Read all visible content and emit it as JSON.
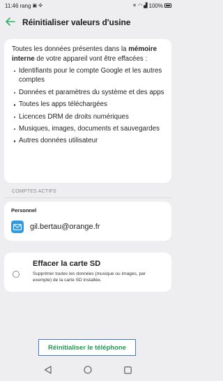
{
  "status_bar": {
    "time": "11:46",
    "carrier_fragment": "rang",
    "battery": "100%"
  },
  "header": {
    "title": "Réinitialiser valeurs d'usine"
  },
  "warning": {
    "intro_part1": "Toutes les données présentes dans la ",
    "intro_bold": "mémoire interne",
    "intro_part2": " de votre appareil vont être effacées :",
    "bullets": [
      "Identifiants pour le compte Google et les autres comptes",
      "Données et paramètres du système et des apps",
      "Toutes les apps téléchargées",
      "Licences DRM de droits numériques",
      "Musiques, images, documents et sauvegardes",
      "Autres données utilisateur"
    ]
  },
  "accounts": {
    "section_label": "COMPTES ACTIFS",
    "type": "Personnel",
    "email": "gil.bertau@orange.fr"
  },
  "sd_card": {
    "title": "Effacer la carte SD",
    "description": "Supprimer toutes les données (musique ou images, par exemple) de la carte SD installée.",
    "checked": false
  },
  "action": {
    "reset_label": "Réinitialiser le téléphone"
  },
  "colors": {
    "accent_green": "#2bb06a",
    "reset_text": "#1e9b4e",
    "highlight_border": "#3f79d6",
    "mail_icon_bg": "#2e9bde"
  }
}
